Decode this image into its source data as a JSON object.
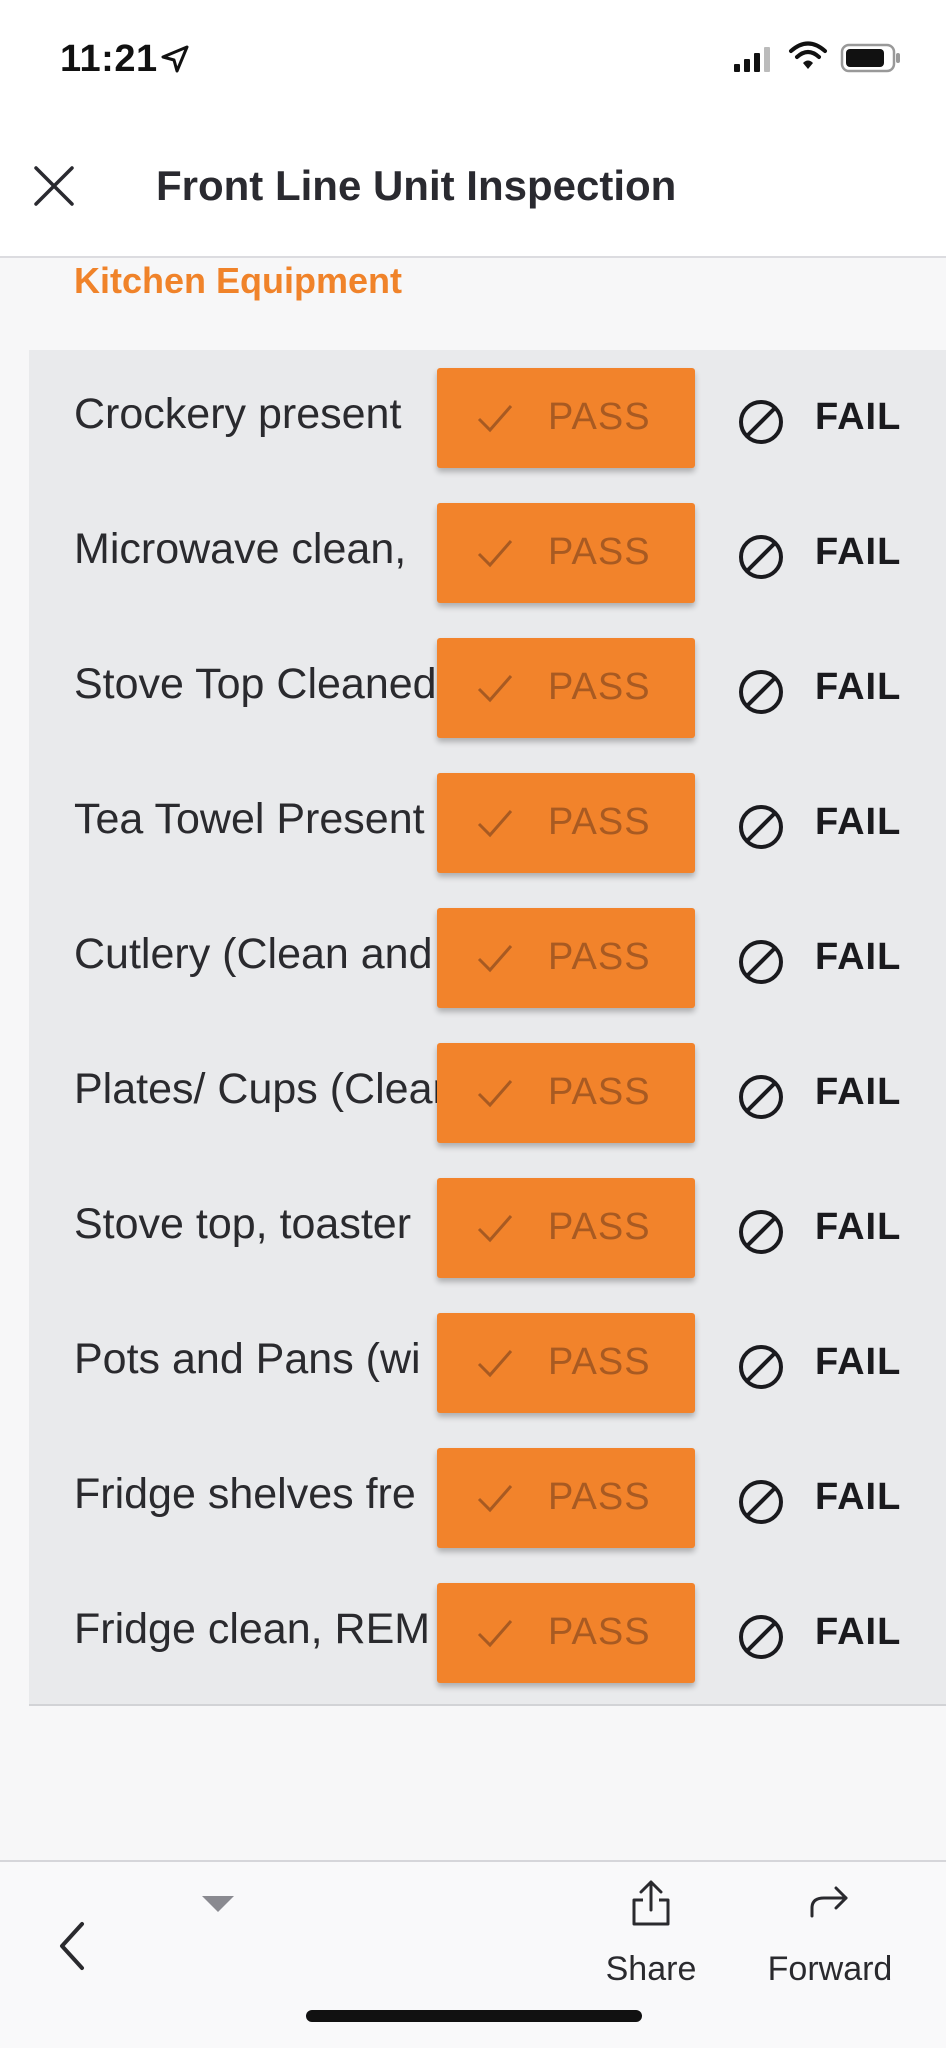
{
  "status_bar": {
    "time": "11:21"
  },
  "header": {
    "title": "Front Line Unit Inspection"
  },
  "section": {
    "title": "Kitchen Equipment"
  },
  "items": [
    {
      "label": "Crockery present",
      "pass_label": "PASS",
      "fail_label": "FAIL"
    },
    {
      "label": "Microwave clean,",
      "pass_label": "PASS",
      "fail_label": "FAIL"
    },
    {
      "label": "Stove Top Cleaned",
      "pass_label": "PASS",
      "fail_label": "FAIL"
    },
    {
      "label": "Tea Towel Present",
      "pass_label": "PASS",
      "fail_label": "FAIL"
    },
    {
      "label": "Cutlery (Clean and",
      "pass_label": "PASS",
      "fail_label": "FAIL"
    },
    {
      "label": "Plates/ Cups (Clean",
      "pass_label": "PASS",
      "fail_label": "FAIL"
    },
    {
      "label": "Stove top, toaster",
      "pass_label": "PASS",
      "fail_label": "FAIL"
    },
    {
      "label": "Pots and Pans (wi",
      "pass_label": "PASS",
      "fail_label": "FAIL"
    },
    {
      "label": "Fridge shelves fre",
      "pass_label": "PASS",
      "fail_label": "FAIL"
    },
    {
      "label": "Fridge clean, REM",
      "pass_label": "PASS",
      "fail_label": "FAIL"
    }
  ],
  "toolbar": {
    "share_label": "Share",
    "forward_label": "Forward"
  },
  "colors": {
    "accent": "#f2832b",
    "section_title": "#f0832a",
    "list_background": "#e9eaec"
  }
}
